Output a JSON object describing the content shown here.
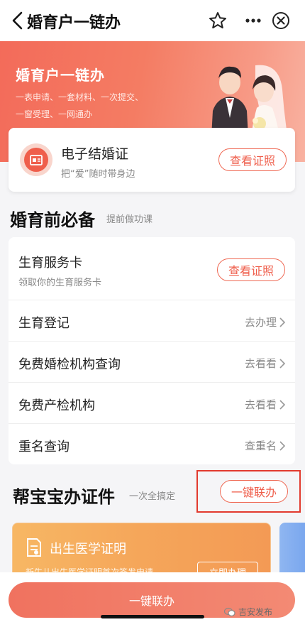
{
  "nav": {
    "title": "婚育户一链办"
  },
  "hero": {
    "title": "婚育户一链办",
    "line1": "一表申请、一套材料、一次提交、",
    "line2": "一窗受理、一网通办"
  },
  "cert_card": {
    "title": "电子结婚证",
    "subtitle": "把“爱”随时带身边",
    "button": "查看证照"
  },
  "section_prep": {
    "title": "婚育前必备",
    "subtitle": "提前做功课"
  },
  "list": [
    {
      "label": "生育服务卡",
      "sub": "领取你的生育服务卡",
      "action": "查看证照"
    },
    {
      "label": "生育登记",
      "action": "去办理"
    },
    {
      "label": "免费婚检机构查询",
      "action": "去看看"
    },
    {
      "label": "免费产检机构",
      "action": "去看看"
    },
    {
      "label": "重名查询",
      "action": "查重名"
    }
  ],
  "section_baby": {
    "title": "帮宝宝办证件",
    "subtitle": "一次全搞定",
    "button": "一键联办"
  },
  "baby_card": {
    "title": "出生医学证明",
    "desc": "新生儿出生医学证明首次签发申请",
    "button": "立即办理"
  },
  "bottom": {
    "button": "一键联办"
  },
  "watermark": "吉安发布",
  "colors": {
    "accent": "#ef5e4b",
    "hero_start": "#f36b5a",
    "baby_card": "#f5a65a",
    "highlight": "#e23a2e"
  },
  "icons": [
    "back-chevron-icon",
    "star-icon",
    "more-icon",
    "close-circle-icon",
    "certificate-icon",
    "document-icon",
    "chevron-right-icon"
  ]
}
